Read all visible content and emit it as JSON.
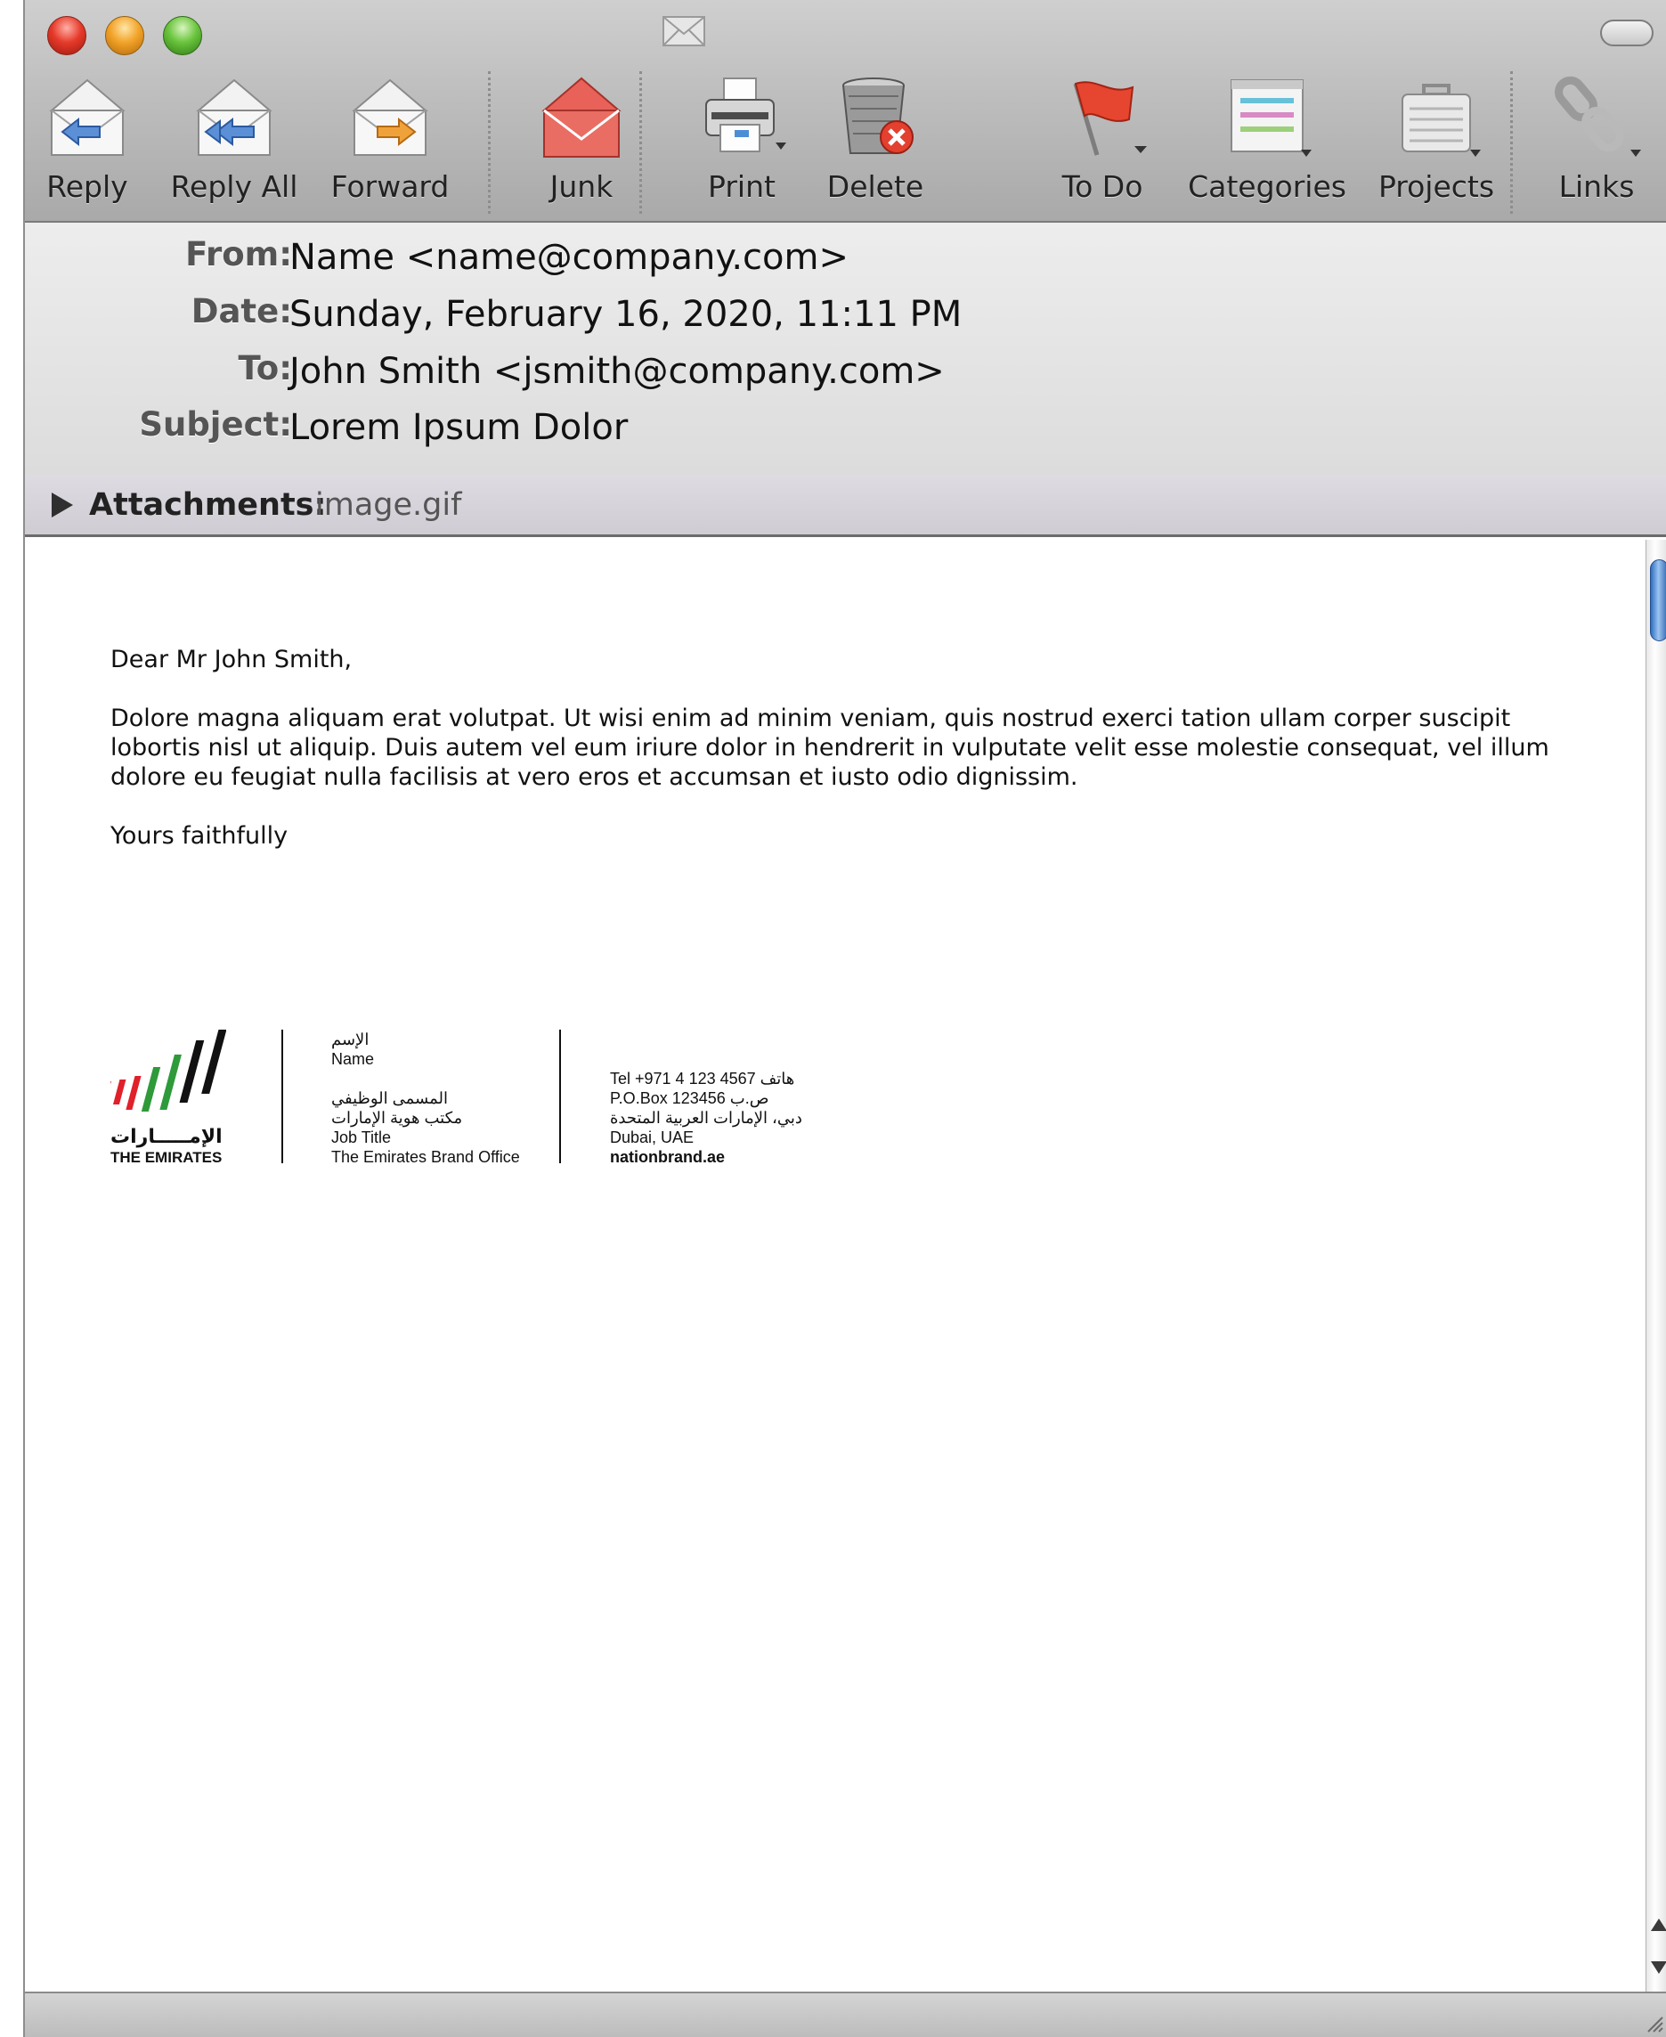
{
  "window": {
    "title_icon": "envelope-icon",
    "controls": [
      "close",
      "minimize",
      "zoom"
    ]
  },
  "toolbar": {
    "buttons": [
      {
        "label": "Reply",
        "icon": "reply-envelope-icon"
      },
      {
        "label": "Reply All",
        "icon": "reply-all-envelope-icon"
      },
      {
        "label": "Forward",
        "icon": "forward-envelope-icon"
      },
      {
        "label": "Junk",
        "icon": "junk-envelope-icon"
      },
      {
        "label": "Print",
        "icon": "printer-icon"
      },
      {
        "label": "Delete",
        "icon": "trash-delete-icon"
      },
      {
        "label": "To Do",
        "icon": "flag-icon"
      },
      {
        "label": "Categories",
        "icon": "categories-icon"
      },
      {
        "label": "Projects",
        "icon": "briefcase-icon"
      },
      {
        "label": "Links",
        "icon": "chain-link-icon"
      }
    ]
  },
  "header": {
    "from_label": "From:",
    "from_value": "Name <name@company.com>",
    "date_label": "Date:",
    "date_value": "Sunday, February 16, 2020, 11:11 PM",
    "to_label": "To:",
    "to_value": "John Smith <jsmith@company.com>",
    "subject_label": "Subject:",
    "subject_value": "Lorem Ipsum Dolor"
  },
  "attachments": {
    "label": "Attachments:",
    "file": "image.gif"
  },
  "message": {
    "greeting": "Dear Mr John Smith,",
    "paragraph": "Dolore magna aliquam erat volutpat. Ut wisi enim ad minim veniam, quis nostrud exerci tation ullam corper suscipit lobortis nisl ut aliquip. Duis autem vel eum iriure dolor in hendrerit in vulputate velit esse molestie consequat, vel illum dolore eu feugiat nulla facilisis at vero eros et accumsan et iusto odio dignissim.",
    "closing": "Yours faithfully"
  },
  "signature": {
    "logo_ar": "الإمـــــارات",
    "logo_en": "THE EMIRATES",
    "name_ar": "الإسم",
    "name_en": "Name",
    "job_ar": "المسمى الوظيفي",
    "office_ar": "مكتب هوية الإمارات",
    "job_en": "Job Title",
    "office_en": "The Emirates Brand Office",
    "tel": "Tel +971 4 123 4567 هاتف",
    "pobox": "P.O.Box  123456  ص.ب",
    "city_ar": "دبي، الإمارات العربية المتحدة",
    "city_en": "Dubai, UAE",
    "website": "nationbrand.ae"
  },
  "colors": {
    "toolbar_top": "#cfcfcf",
    "toolbar_bottom": "#a9a9a9",
    "header_bg": "#e5e5e5",
    "attach_bar_bg": "#d8d5dc",
    "scroll_thumb": "#3a78c8",
    "logo_red": "#e0202a",
    "logo_green": "#2e9a3a",
    "logo_black": "#111111"
  }
}
